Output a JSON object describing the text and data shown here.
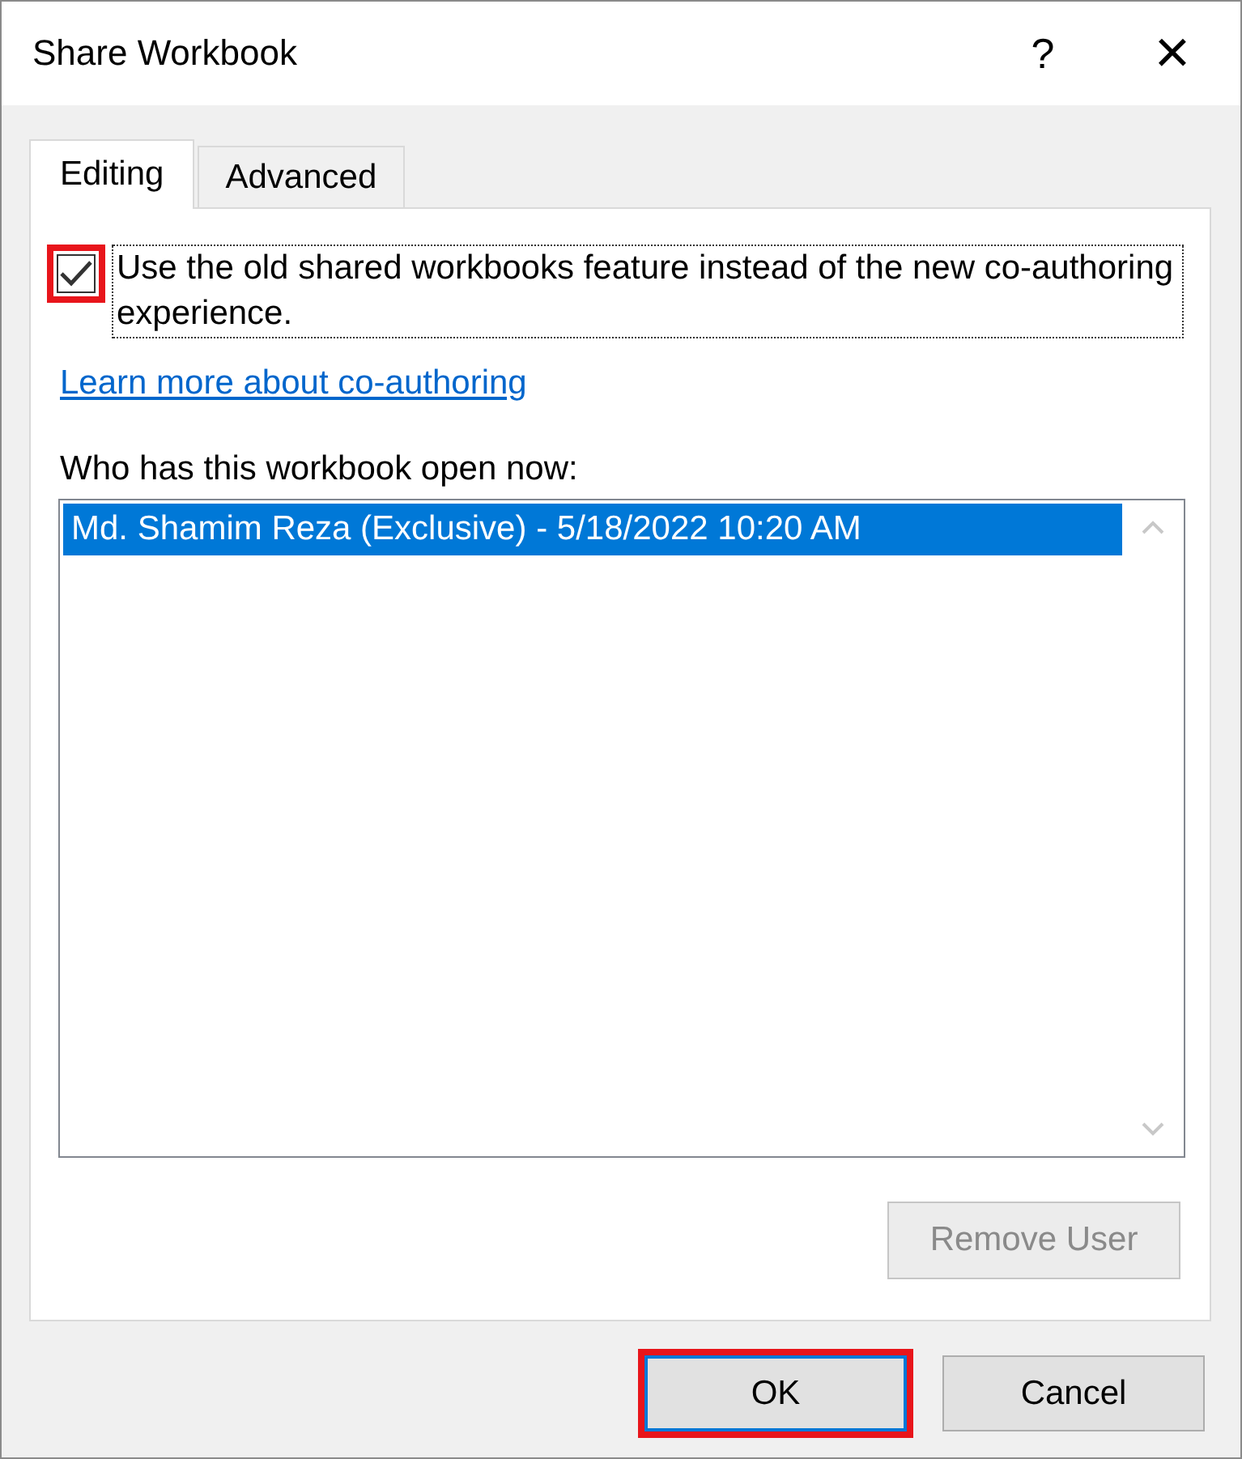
{
  "window": {
    "title": "Share Workbook",
    "help": "?",
    "close": "×"
  },
  "tabs": [
    {
      "label": "Editing",
      "selected": true
    },
    {
      "label": "Advanced",
      "selected": false
    }
  ],
  "option": {
    "label": "Use the old shared workbooks feature instead of the new co-authoring experience.",
    "checked": true,
    "highlighted": true
  },
  "link": "Learn more about co-authoring",
  "users": {
    "label": "Who has this workbook open now:",
    "items": [
      {
        "text": "Md. Shamim Reza (Exclusive) - 5/18/2022 10:20 AM",
        "selected": true
      }
    ]
  },
  "remove_button": {
    "label": "Remove User",
    "disabled": true
  },
  "buttons": [
    {
      "label": "OK",
      "default": true,
      "highlighted": true
    },
    {
      "label": "Cancel",
      "default": false,
      "highlighted": false
    }
  ]
}
